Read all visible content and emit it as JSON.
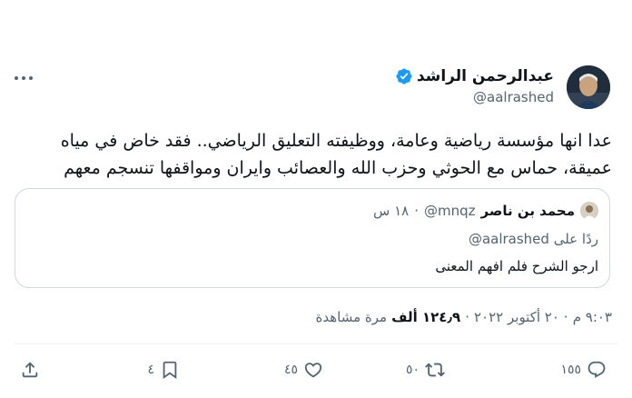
{
  "tweet": {
    "author": {
      "name": "عبدالرحمن الراشد",
      "handle": "@aalrashed",
      "verified": true,
      "avatar": "avatar"
    },
    "more_icon": "more-icon",
    "text_lines": [
      "عدا انها مؤسسة رياضية وعامة، ووظيفته التعليق الرياضي.. فقد خاض في مياه",
      "عميقة، حماس مع الحوثي وحزب الله والعصائب وايران ومواقفها تنسجم معهم"
    ],
    "quoted": {
      "name": "محمد بن ناصر",
      "handle": "@mnqz",
      "dot": "·",
      "time": "١٨ س",
      "reply_prefix": "ردًا على",
      "reply_to": "@aalrashed",
      "text": "ارجو الشرح فلم افهم المعنى"
    },
    "meta": {
      "time": "٩:٠٣ م",
      "dot1": "·",
      "date": "٢٠ أكتوبر ٢٠٢٢",
      "dot2": "·",
      "views_count": "١٢٤٫٩ ألف",
      "views_label": "مرة مشاهدة"
    },
    "actions": {
      "replies": "١٥٥",
      "retweets": "٥٠",
      "likes": "٤٥",
      "bookmarks": "٤",
      "reply_icon": "reply-icon",
      "retweet_icon": "retweet-icon",
      "like_icon": "heart-icon",
      "bookmark_icon": "bookmark-icon",
      "share_icon": "share-icon"
    },
    "colors": {
      "text": "#0f1419",
      "muted": "#536471",
      "border": "#cfd9de",
      "verified": "#1d9bf0"
    }
  }
}
